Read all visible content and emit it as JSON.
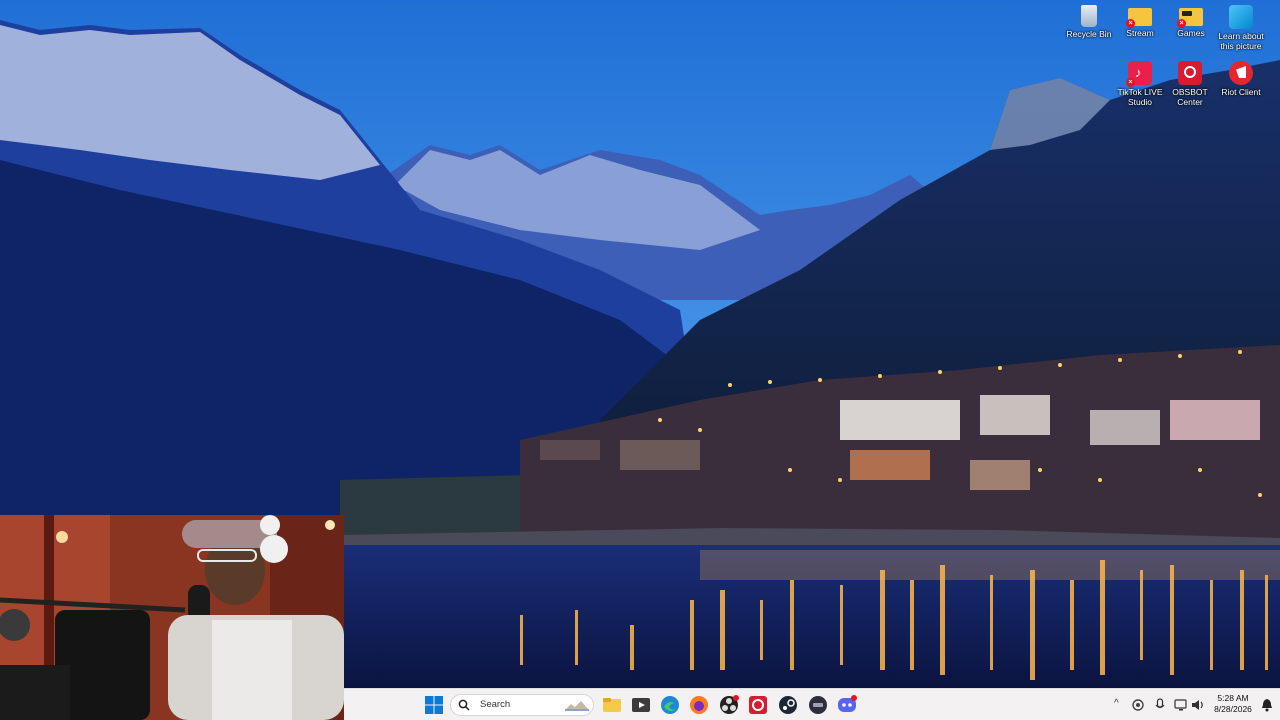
{
  "desktop_icons": [
    {
      "label": "Recycle Bin",
      "icon": "recycle-bin-icon"
    },
    {
      "label": "Stream",
      "icon": "folder-icon"
    },
    {
      "label": "Games",
      "icon": "folder-icon"
    },
    {
      "label": "Learn about this picture",
      "icon": "spotlight-icon"
    },
    {
      "label": "TikTok LIVE Studio",
      "icon": "tiktok-icon"
    },
    {
      "label": "OBSBOT Center",
      "icon": "obsbot-icon"
    },
    {
      "label": "Riot Client",
      "icon": "riot-icon"
    }
  ],
  "taskbar": {
    "search_placeholder": "Search",
    "pinned": [
      "windows-start-icon",
      "file-explorer-icon",
      "media-player-icon",
      "edge-icon",
      "firefox-icon",
      "obs-icon",
      "obsbot-icon",
      "steam-icon",
      "app-icon",
      "discord-icon"
    ],
    "clock_time": "5:28 AM",
    "clock_date": "8/28/2026"
  },
  "colors": {
    "taskbar_bg": "#f3f1f2",
    "sky": "#3b86e0",
    "accent": "#0078d4"
  }
}
